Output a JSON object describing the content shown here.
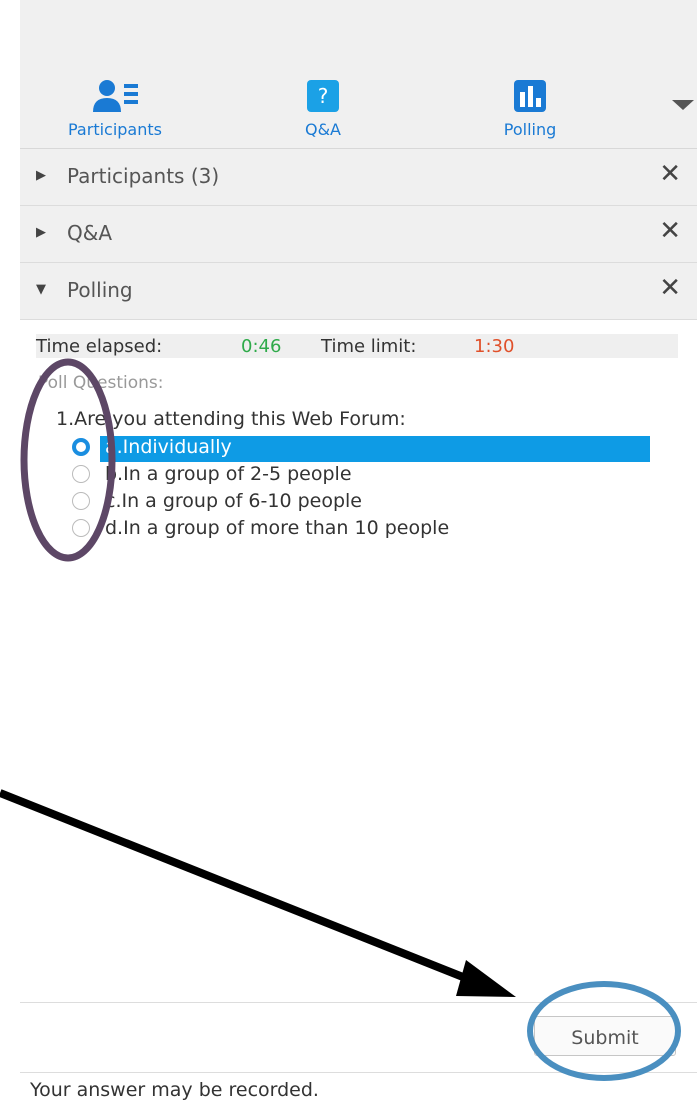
{
  "toolbar": {
    "participants_label": "Participants",
    "qa_label": "Q&A",
    "polling_label": "Polling",
    "accent_color": "#1a7ad4"
  },
  "sections": {
    "participants_title": "Participants (3)",
    "qa_title": "Q&A",
    "polling_title": "Polling",
    "close_glyph": "✕"
  },
  "poll": {
    "time_elapsed_label": "Time elapsed:",
    "time_elapsed_value": "0:46",
    "time_limit_label": "Time limit:",
    "time_limit_value": "1:30",
    "questions_label": "Poll Questions:",
    "question": "1.Are you attending this Web Forum:",
    "options": [
      "a.Individually",
      "b.In a group of 2-5 people",
      "c.In a group of 6-10 people",
      "d.In a group of more than 10 people"
    ],
    "selected_option": 0
  },
  "footer": {
    "submit_label": "Submit",
    "note": "Your answer may be recorded."
  }
}
